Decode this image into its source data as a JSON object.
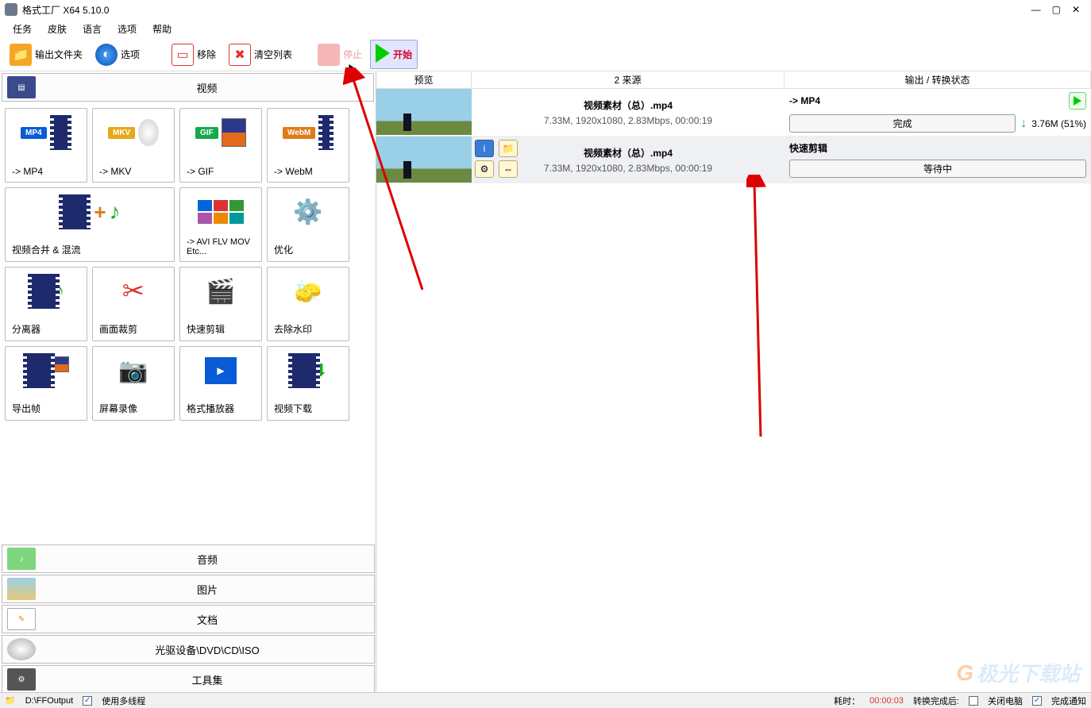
{
  "titlebar": {
    "title": "格式工厂 X64 5.10.0"
  },
  "menu": {
    "items": [
      "任务",
      "皮肤",
      "语言",
      "选项",
      "帮助"
    ]
  },
  "toolbar": {
    "outputFolder": "输出文件夹",
    "options": "选项",
    "remove": "移除",
    "clearList": "清空列表",
    "stop": "停止",
    "start": "开始"
  },
  "categories": {
    "video": "视频",
    "audio": "音频",
    "picture": "图片",
    "document": "文档",
    "optical": "光驱设备\\DVD\\CD\\ISO",
    "tools": "工具集"
  },
  "grid": {
    "mp4_badge": "MP4",
    "mp4": "-> MP4",
    "mkv_badge": "MKV",
    "mkv": "-> MKV",
    "gif_badge": "GIF",
    "gif": "-> GIF",
    "webm_badge": "WebM",
    "webm": "-> WebM",
    "joiner": "视频合并 & 混流",
    "avietc": "-> AVI FLV MOV Etc...",
    "optimize": "优化",
    "separator": "分离器",
    "crop": "画面裁剪",
    "quicktrim": "快速剪辑",
    "dewatermark": "去除水印",
    "exportframe": "导出帧",
    "screenrec": "屏幕录像",
    "player": "格式播放器",
    "downloader": "视频下载"
  },
  "table": {
    "headers": {
      "preview": "预览",
      "source": "2 来源",
      "output": "输出 / 转换状态"
    },
    "rows": [
      {
        "filename": "视频素材（总）.mp4",
        "meta": "7.33M, 1920x1080, 2.83Mbps, 00:00:19",
        "target": "-> MP4",
        "status": "完成",
        "outsize": "3.76M (51%)"
      },
      {
        "filename": "视频素材（总）.mp4",
        "meta": "7.33M, 1920x1080, 2.83Mbps, 00:00:19",
        "target": "快速剪辑",
        "status": "等待中",
        "outsize": ""
      }
    ]
  },
  "status": {
    "outputPath": "D:\\FFOutput",
    "multithread": "使用多线程",
    "elapsed_label": "耗时：",
    "elapsed": "00:00:03",
    "afterLabel": "转换完成后:",
    "afterAction": "关闭电脑",
    "doneNotify": "完成通知"
  },
  "watermark": "极光下载站"
}
